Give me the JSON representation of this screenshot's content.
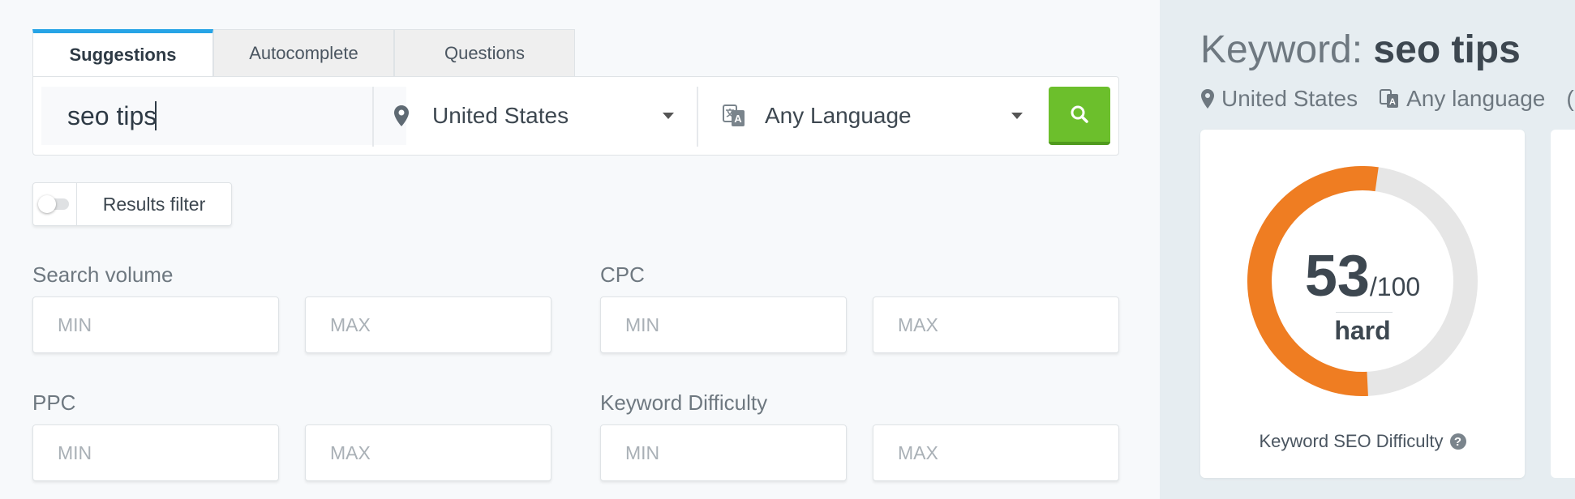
{
  "tabs": [
    {
      "label": "Suggestions",
      "active": true
    },
    {
      "label": "Autocomplete",
      "active": false
    },
    {
      "label": "Questions",
      "active": false
    }
  ],
  "search": {
    "keyword_value": "seo tips",
    "country": "United States",
    "language": "Any Language",
    "submit_icon": "search-icon"
  },
  "filter": {
    "label": "Results filter",
    "enabled": false
  },
  "filters": {
    "search_volume": {
      "label": "Search volume",
      "min_placeholder": "MIN",
      "max_placeholder": "MAX"
    },
    "cpc": {
      "label": "CPC",
      "min_placeholder": "MIN",
      "max_placeholder": "MAX"
    },
    "ppc": {
      "label": "PPC",
      "min_placeholder": "MIN",
      "max_placeholder": "MAX"
    },
    "keyword_difficulty": {
      "label": "Keyword Difficulty",
      "min_placeholder": "MIN",
      "max_placeholder": "MAX"
    }
  },
  "detail": {
    "title_prefix": "Keyword: ",
    "keyword": "seo tips",
    "country": "United States",
    "language": "Any language",
    "difficulty_score": "53",
    "difficulty_max": "/100",
    "difficulty_value": 53,
    "difficulty_word": "hard",
    "difficulty_caption": "Keyword SEO Difficulty",
    "help_glyph": "?"
  },
  "colors": {
    "accent_tab": "#27a4e6",
    "search_button": "#6cbf2c",
    "gauge_fill": "#ef7d22",
    "gauge_track": "#e6e6e6"
  }
}
